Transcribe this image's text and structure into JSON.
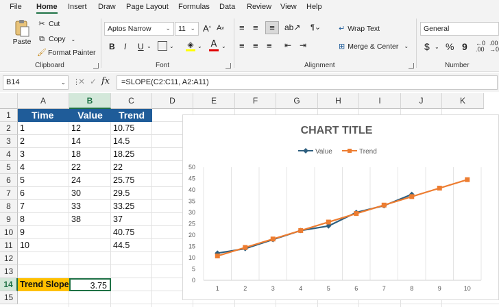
{
  "menu": {
    "tabs": [
      "File",
      "Home",
      "Insert",
      "Draw",
      "Page Layout",
      "Formulas",
      "Data",
      "Review",
      "View",
      "Help"
    ],
    "active": "Home"
  },
  "ribbon": {
    "clipboard": {
      "paste": "Paste",
      "cut": "Cut",
      "copy": "Copy",
      "format_painter": "Format Painter",
      "label": "Clipboard"
    },
    "font": {
      "font_name": "Aptos Narrow",
      "font_size": "11",
      "bold": "B",
      "italic": "I",
      "underline": "U",
      "label": "Font"
    },
    "alignment": {
      "wrap_text": "Wrap Text",
      "merge_center": "Merge & Center",
      "label": "Alignment"
    },
    "number": {
      "format": "General",
      "currency": "$",
      "percent": "%",
      "comma": "9",
      "label": "Number"
    }
  },
  "formula_bar": {
    "name_box": "B14",
    "fx": "fx",
    "formula": "=SLOPE(C2:C11, A2:A11)"
  },
  "columns": [
    "A",
    "B",
    "C",
    "D",
    "E",
    "F",
    "G",
    "H",
    "I",
    "J",
    "K"
  ],
  "rows": [
    "1",
    "2",
    "3",
    "4",
    "5",
    "6",
    "7",
    "8",
    "9",
    "10",
    "11",
    "12",
    "13",
    "14",
    "15"
  ],
  "table": {
    "headers": [
      "Time",
      "Value",
      "Trend"
    ],
    "rows": [
      [
        "1",
        "12",
        "10.75"
      ],
      [
        "2",
        "14",
        "14.5"
      ],
      [
        "3",
        "18",
        "18.25"
      ],
      [
        "4",
        "22",
        "22"
      ],
      [
        "5",
        "24",
        "25.75"
      ],
      [
        "6",
        "30",
        "29.5"
      ],
      [
        "7",
        "33",
        "33.25"
      ],
      [
        "8",
        "38",
        "37"
      ],
      [
        "9",
        "",
        "40.75"
      ],
      [
        "10",
        "",
        "44.5"
      ]
    ]
  },
  "slope": {
    "label": "Trend Slope",
    "value": "3.75"
  },
  "colors": {
    "header_fill": "#1f5c99",
    "label_fill": "#ffc000",
    "accent": "#1e7145",
    "value_line": "#2e5f7f",
    "trend_line": "#ed7d31"
  },
  "chart_data": {
    "type": "line",
    "title": "CHART TITLE",
    "x": [
      1,
      2,
      3,
      4,
      5,
      6,
      7,
      8,
      9,
      10
    ],
    "series": [
      {
        "name": "Value",
        "values": [
          12,
          14,
          18,
          22,
          24,
          30,
          33,
          38,
          null,
          null
        ],
        "color": "#2e5f7f",
        "marker": "diamond"
      },
      {
        "name": "Trend",
        "values": [
          10.75,
          14.5,
          18.25,
          22,
          25.75,
          29.5,
          33.25,
          37,
          40.75,
          44.5
        ],
        "color": "#ed7d31",
        "marker": "square"
      }
    ],
    "ylim": [
      0,
      50
    ],
    "yticks": [
      0,
      5,
      10,
      15,
      20,
      25,
      30,
      35,
      40,
      45,
      50
    ],
    "xticks": [
      "1",
      "2",
      "3",
      "4",
      "5",
      "6",
      "7",
      "8",
      "9",
      "10"
    ],
    "grid": "vertical",
    "legend": "top"
  }
}
